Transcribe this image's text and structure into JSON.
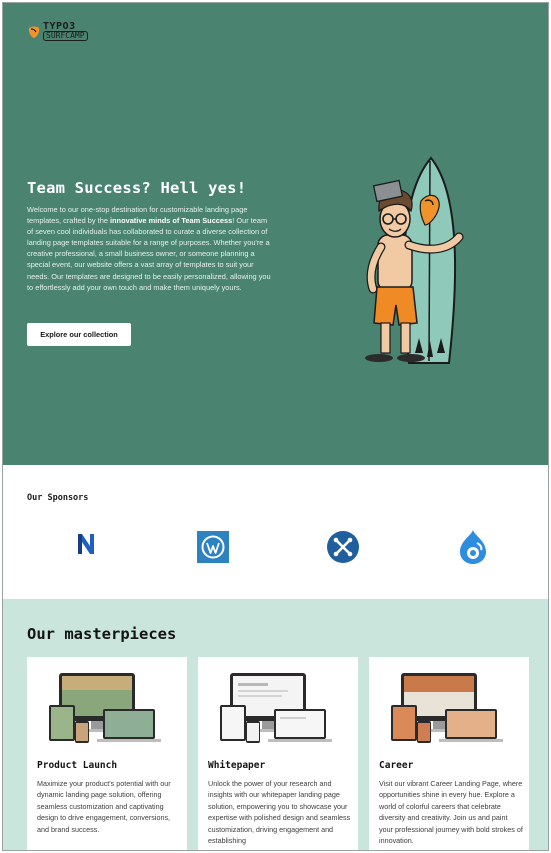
{
  "brand": {
    "line1": "TYPO3",
    "line2": "SURFCAMP",
    "logo_icon": "typo3-swoosh-icon",
    "accent": "#f0932b"
  },
  "hero": {
    "title": "Team Success? Hell yes!",
    "text_before": "Welcome to our one-stop destination for customizable landing page templates, crafted by the ",
    "text_bold": "innovative minds of Team Success",
    "text_after": "! Our team of seven cool individuals has collaborated to curate a diverse collection of landing page templates suitable for a range of purposes. Whether you're a creative professional, a small business owner, or someone planning a special event, our website offers a vast array of templates to suit your needs. Our templates are designed to be easily personalized, allowing you to effortlessly add your own touch and make them uniquely yours.",
    "button_label": "Explore our collection",
    "illustration": "surfer-with-surfboard-illustration",
    "bg_color": "#4a8470"
  },
  "sponsors": {
    "title": "Our Sponsors",
    "items": [
      {
        "name": "N",
        "icon": "neos-logo-icon",
        "color": "#1f5fbf"
      },
      {
        "name": "WordPress",
        "icon": "wordpress-logo-icon",
        "color": "#2d82c2"
      },
      {
        "name": "Joomla",
        "icon": "joomla-logo-icon",
        "color": "#1f5f9e"
      },
      {
        "name": "Drupal",
        "icon": "drupal-logo-icon",
        "color": "#2f8de0"
      }
    ]
  },
  "masterpieces": {
    "title": "Our masterpieces",
    "bg_color": "#c9e5dc",
    "cards": [
      {
        "title": "Product Launch",
        "text": "Maximize your product's potential with our dynamic landing page solution, offering seamless customization and captivating design to drive engagement, conversions, and brand success.",
        "image": "devices-mockup-image"
      },
      {
        "title": "Whitepaper",
        "text": "Unlock the power of your research and insights with our whitepaper landing page solution, empowering you to showcase your expertise with polished design and seamless customization, driving engagement and establishing",
        "image": "devices-mockup-image"
      },
      {
        "title": "Career",
        "text": "Visit our vibrant Career Landing Page, where opportunities shine in every hue. Explore a world of colorful careers that celebrate diversity and creativity. Join us and paint your professional journey with bold strokes of innovation.",
        "image": "devices-mockup-image"
      }
    ]
  }
}
